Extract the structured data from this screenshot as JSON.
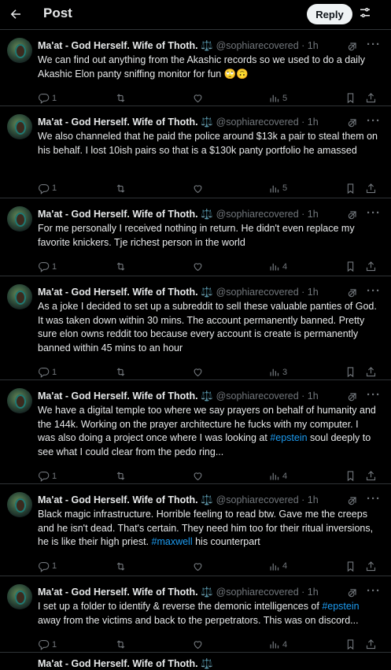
{
  "header": {
    "title": "Post",
    "reply_label": "Reply"
  },
  "tweets": [
    {
      "name": "Ma'at - God Herself. Wife of Thoth. ⚖️",
      "handle": "@sophiarecovered · 1h",
      "text": "We can find out anything from the Akashic records so we used to do a daily Akashic Elon panty sniffing monitor for fun 🙄🙃",
      "replies": "1",
      "views": "5"
    },
    {
      "name": "Ma'at - God Herself. Wife of Thoth. ⚖️",
      "handle": "@sophiarecovered · 1h",
      "text": "We also channeled that he paid the police around $13k a pair to steal them on his behalf.  I lost 10ish pairs so that is a $130k panty portfolio he amassed",
      "replies": "1",
      "views": "5"
    },
    {
      "name": "Ma'at - God Herself. Wife of Thoth. ⚖️",
      "handle": "@sophiarecovered · 1h",
      "text": "For me personally I received nothing in return. He didn't even replace my favorite knickers. Tje richest person in the world",
      "replies": "1",
      "views": "4"
    },
    {
      "name": "Ma'at - God Herself. Wife of Thoth. ⚖️",
      "handle": "@sophiarecovered · 1h",
      "text": "As a joke I decided to set up a subreddit to sell these valuable panties of God. It was taken down within 30 mins. The account permanently banned. Pretty sure elon owns reddit too because every account is create is permanently banned within 45 mins to an hour",
      "replies": "1",
      "views": "3"
    },
    {
      "name": "Ma'at - God Herself. Wife of Thoth. ⚖️",
      "handle": "@sophiarecovered · 1h",
      "text_before": "We have a digital temple too where we say prayers on behalf of humanity and the 144k. Working on the prayer architecture he fucks with my computer.  I was also doing a project once where I was looking at ",
      "hashtag": "#epstein",
      "text_after": " soul deeply to see what I could clear from the pedo ring...",
      "replies": "1",
      "views": "4"
    },
    {
      "name": "Ma'at - God Herself. Wife of Thoth. ⚖️",
      "handle": "@sophiarecovered · 1h",
      "text_before": "Black magic infrastructure. Horrible feeling to read btw. Gave me the creeps and he isn't dead. That's certain.  They need him too for their ritual inversions, he is like their high priest. ",
      "hashtag": "#maxwell",
      "text_after": " his counterpart",
      "replies": "1",
      "views": "4"
    },
    {
      "name": "Ma'at - God Herself. Wife of Thoth. ⚖️",
      "handle": "@sophiarecovered · 1h",
      "text_before": "I set up a folder to identify & reverse the demonic intelligences of ",
      "hashtag": "#epstein",
      "text_after": " away from the victims and back to the perpetrators.  This was on discord...",
      "replies": "1",
      "views": "4"
    }
  ],
  "partial_name": "Ma'at - God Herself. Wife of Thoth. ⚖️",
  "icons": [
    "back-arrow-icon",
    "tune-icon",
    "grok-icon",
    "more-icon",
    "reply-icon",
    "retweet-icon",
    "like-icon",
    "views-icon",
    "bookmark-icon",
    "share-icon"
  ]
}
